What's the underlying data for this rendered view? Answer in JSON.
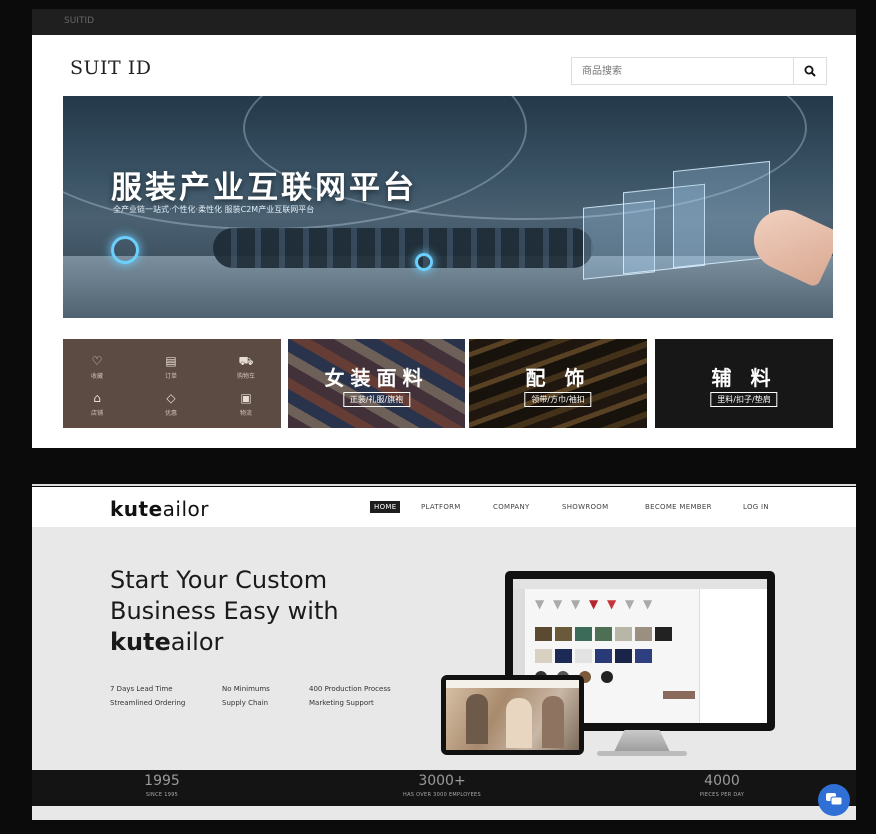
{
  "tabbar": {
    "title": "SUITID"
  },
  "site1": {
    "brand": "SUIT ID",
    "search": {
      "placeholder": "商品搜索"
    },
    "banner": {
      "title": "服装产业互联网平台",
      "subtitle": "全产业链一站式·个性化·柔性化 服装C2M产业互联网平台"
    },
    "menu": [
      {
        "icon": "heart-icon",
        "label": "收藏"
      },
      {
        "icon": "order-icon",
        "label": "订单"
      },
      {
        "icon": "cart-icon",
        "label": "购物车"
      },
      {
        "icon": "shop-icon",
        "label": "店铺"
      },
      {
        "icon": "tag-icon",
        "label": "优惠"
      },
      {
        "icon": "box-icon",
        "label": "物流"
      }
    ],
    "categories": [
      {
        "title": "女装面料",
        "tag": "正装/礼服/旗袍"
      },
      {
        "title": "配 饰",
        "tag": "领带/方巾/袖扣"
      },
      {
        "title": "辅 料",
        "tag": "里料/扣子/垫肩"
      }
    ]
  },
  "site2": {
    "logo": {
      "prefix": "kute",
      "suffix": "ailor"
    },
    "nav": [
      "HOME",
      "PLATFORM",
      "COMPANY",
      "SHOWROOM",
      "BECOME MEMBER",
      "LOG IN"
    ],
    "hero": {
      "line1": "Start Your Custom",
      "line2": "Business Easy with",
      "brand_prefix": "kute",
      "brand_suffix": "ailor"
    },
    "features": [
      "7 Days Lead Time",
      "No Minimums",
      "400 Production Process",
      "Streamlined Ordering",
      "Supply Chain",
      "Marketing Support"
    ],
    "stats": [
      {
        "number": "1995",
        "label": "SINCE 1995"
      },
      {
        "number": "3000+",
        "label": "HAS OVER 3000 EMPLOYEES"
      },
      {
        "number": "4000",
        "label": "PIECES PER DAY"
      }
    ]
  }
}
